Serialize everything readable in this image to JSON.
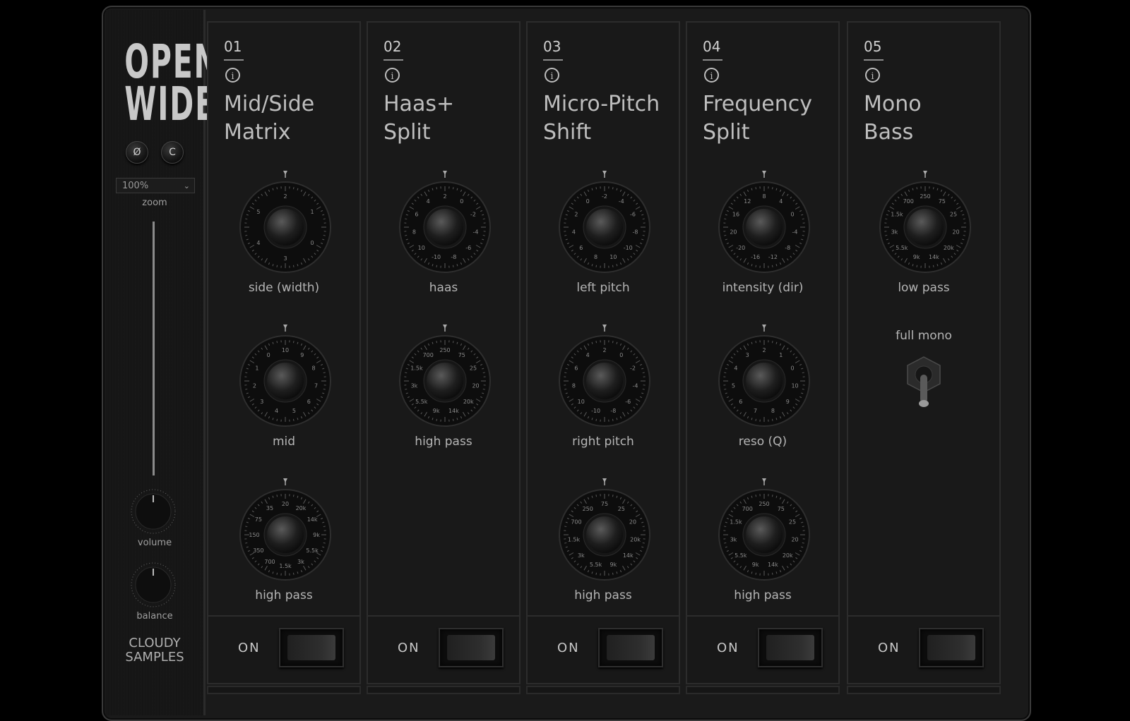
{
  "logo": {
    "line1": "OPEN",
    "line2": "WIDE"
  },
  "sidebar": {
    "phase_button": "Ø",
    "clear_button": "C",
    "zoom_value": "100%",
    "zoom_label": "zoom",
    "volume_label": "volume",
    "balance_label": "balance",
    "brand_line1": "CLOUDY",
    "brand_line2": "SAMPLES"
  },
  "modules": [
    {
      "num": "01",
      "title_line1": "Mid/Side",
      "title_line2": "Matrix",
      "on_label": "ON",
      "knobs": [
        {
          "label": "side (width)",
          "ticks": [
            "2",
            "1",
            "0",
            "3",
            "4",
            "5"
          ]
        },
        {
          "label": "mid",
          "ticks": [
            "10",
            "9",
            "8",
            "7",
            "6",
            "5",
            "4",
            "3",
            "2",
            "1",
            "0"
          ]
        },
        {
          "label": "high pass",
          "ticks": [
            "20",
            "20k",
            "14k",
            "9k",
            "5.5k",
            "3k",
            "1.5k",
            "700",
            "350",
            "150",
            "75",
            "35"
          ]
        }
      ]
    },
    {
      "num": "02",
      "title_line1": "Haas+",
      "title_line2": "Split",
      "on_label": "ON",
      "knobs": [
        {
          "label": "haas",
          "ticks": [
            "2",
            "0",
            "-2",
            "-4",
            "-6",
            "-8",
            "-10",
            "10",
            "8",
            "6",
            "4"
          ]
        },
        {
          "label": "high pass",
          "ticks": [
            "250",
            "75",
            "25",
            "20",
            "20k",
            "14k",
            "9k",
            "5.5k",
            "3k",
            "1.5k",
            "700"
          ]
        }
      ]
    },
    {
      "num": "03",
      "title_line1": "Micro-Pitch",
      "title_line2": "Shift",
      "on_label": "ON",
      "knobs": [
        {
          "label": "left pitch",
          "ticks": [
            "-2",
            "-4",
            "-6",
            "-8",
            "-10",
            "10",
            "8",
            "6",
            "4",
            "2",
            "0"
          ]
        },
        {
          "label": "right pitch",
          "ticks": [
            "2",
            "0",
            "-2",
            "-4",
            "-6",
            "-8",
            "-10",
            "10",
            "8",
            "6",
            "4"
          ]
        },
        {
          "label": "high pass",
          "ticks": [
            "75",
            "25",
            "20",
            "20k",
            "14k",
            "9k",
            "5.5k",
            "3k",
            "1.5k",
            "700",
            "250"
          ]
        }
      ]
    },
    {
      "num": "04",
      "title_line1": "Frequency",
      "title_line2": "Split",
      "on_label": "ON",
      "knobs": [
        {
          "label": "intensity (dir)",
          "ticks": [
            "8",
            "4",
            "0",
            "-4",
            "-8",
            "-12",
            "-16",
            "-20",
            "20",
            "16",
            "12"
          ]
        },
        {
          "label": "reso (Q)",
          "ticks": [
            "2",
            "1",
            "0",
            "10",
            "9",
            "8",
            "7",
            "6",
            "5",
            "4",
            "3"
          ]
        },
        {
          "label": "high pass",
          "ticks": [
            "250",
            "75",
            "25",
            "20",
            "20k",
            "14k",
            "9k",
            "5.5k",
            "3k",
            "1.5k",
            "700"
          ]
        }
      ]
    },
    {
      "num": "05",
      "title_line1": "Mono",
      "title_line2": "Bass",
      "on_label": "ON",
      "toggle_label": "full mono",
      "knobs": [
        {
          "label": "low pass",
          "ticks": [
            "250",
            "75",
            "25",
            "20",
            "20k",
            "14k",
            "9k",
            "5.5k",
            "3k",
            "1.5k",
            "700"
          ]
        }
      ]
    }
  ]
}
